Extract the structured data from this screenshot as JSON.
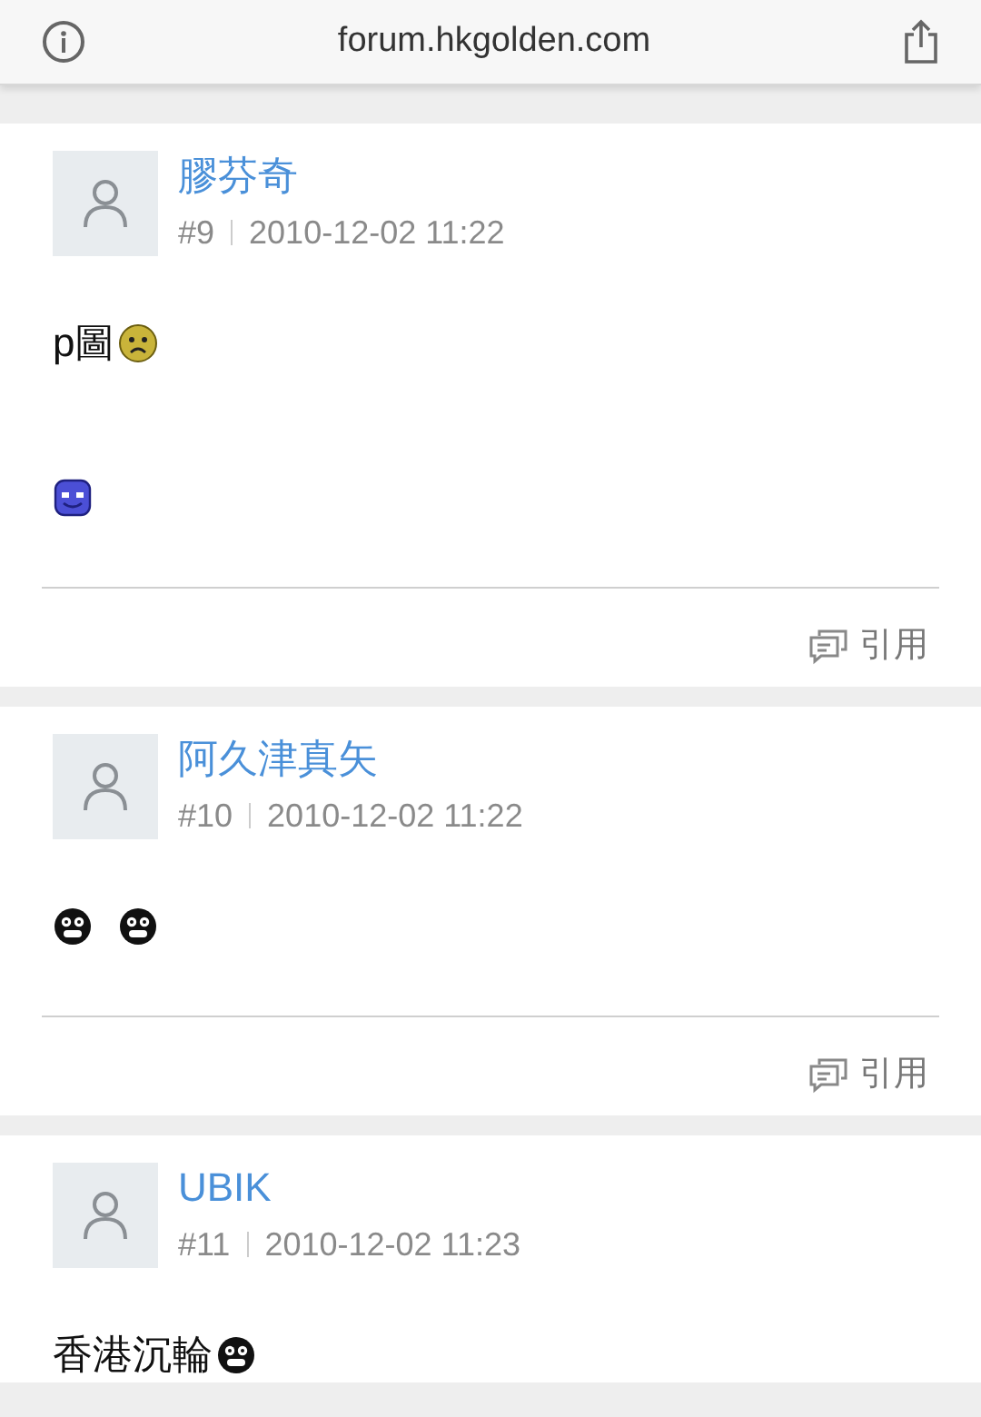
{
  "address_bar": {
    "url": "forum.hkgolden.com"
  },
  "posts": [
    {
      "author": "膠芬奇",
      "number": "#9",
      "time": "2010-12-02 11:22",
      "paragraphs": [
        {
          "segments": [
            {
              "kind": "text",
              "text": "p圖"
            },
            {
              "kind": "sad"
            }
          ]
        },
        {
          "segments": [
            {
              "kind": "blue"
            }
          ]
        }
      ],
      "quote": "引用"
    },
    {
      "author": "阿久津真矢",
      "number": "#10",
      "time": "2010-12-02 11:22",
      "paragraphs": [
        {
          "segments": [
            {
              "kind": "shocked"
            },
            {
              "kind": "shocked"
            }
          ]
        }
      ],
      "quote": "引用"
    },
    {
      "author": "UBIK",
      "number": "#11",
      "time": "2010-12-02 11:23",
      "paragraphs": [
        {
          "segments": [
            {
              "kind": "text",
              "text": "香港沉輪"
            },
            {
              "kind": "shocked"
            }
          ]
        }
      ]
    }
  ]
}
